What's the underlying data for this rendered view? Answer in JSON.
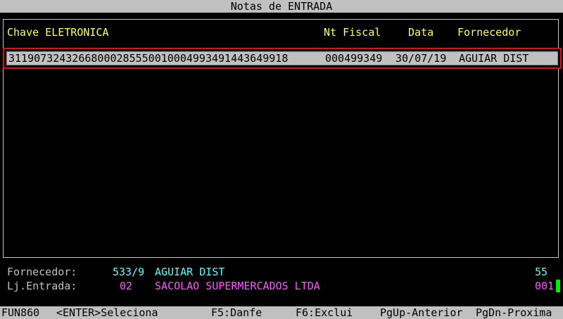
{
  "window": {
    "title": "Notas de ENTRADA"
  },
  "columns": {
    "chave": "Chave ELETRONICA",
    "nt_fiscal": "Nt Fiscal",
    "data": "Data",
    "fornecedor": "Fornecedor"
  },
  "rows": [
    {
      "chave": "31190732432668000285550010004993491443649918",
      "nt_fiscal": "000499349",
      "data": "30/07/19",
      "fornecedor": "AGUIAR DIST"
    }
  ],
  "info": {
    "fornecedor_label": "Fornecedor:",
    "fornecedor_code": "533/9",
    "fornecedor_name": "AGUIAR DIST",
    "fornecedor_right": "55",
    "loja_label": "Lj.Entrada:",
    "loja_code": "02",
    "loja_name": "SACOLAO SUPERMERCADOS LTDA",
    "loja_right": "001"
  },
  "status": {
    "program": "FUN860",
    "enter": "<ENTER>Seleciona",
    "f5": "F5:Danfe",
    "f6": "F6:Exclui",
    "pgup": "PgUp-Anterior",
    "pgdn": "PgDn-Proxima"
  },
  "colors": {
    "header": "#ffff55",
    "fornecedor_info": "#55ffff",
    "loja_info": "#ff55ff",
    "selection_border": "#e01010",
    "cursor": "#00ee00"
  }
}
